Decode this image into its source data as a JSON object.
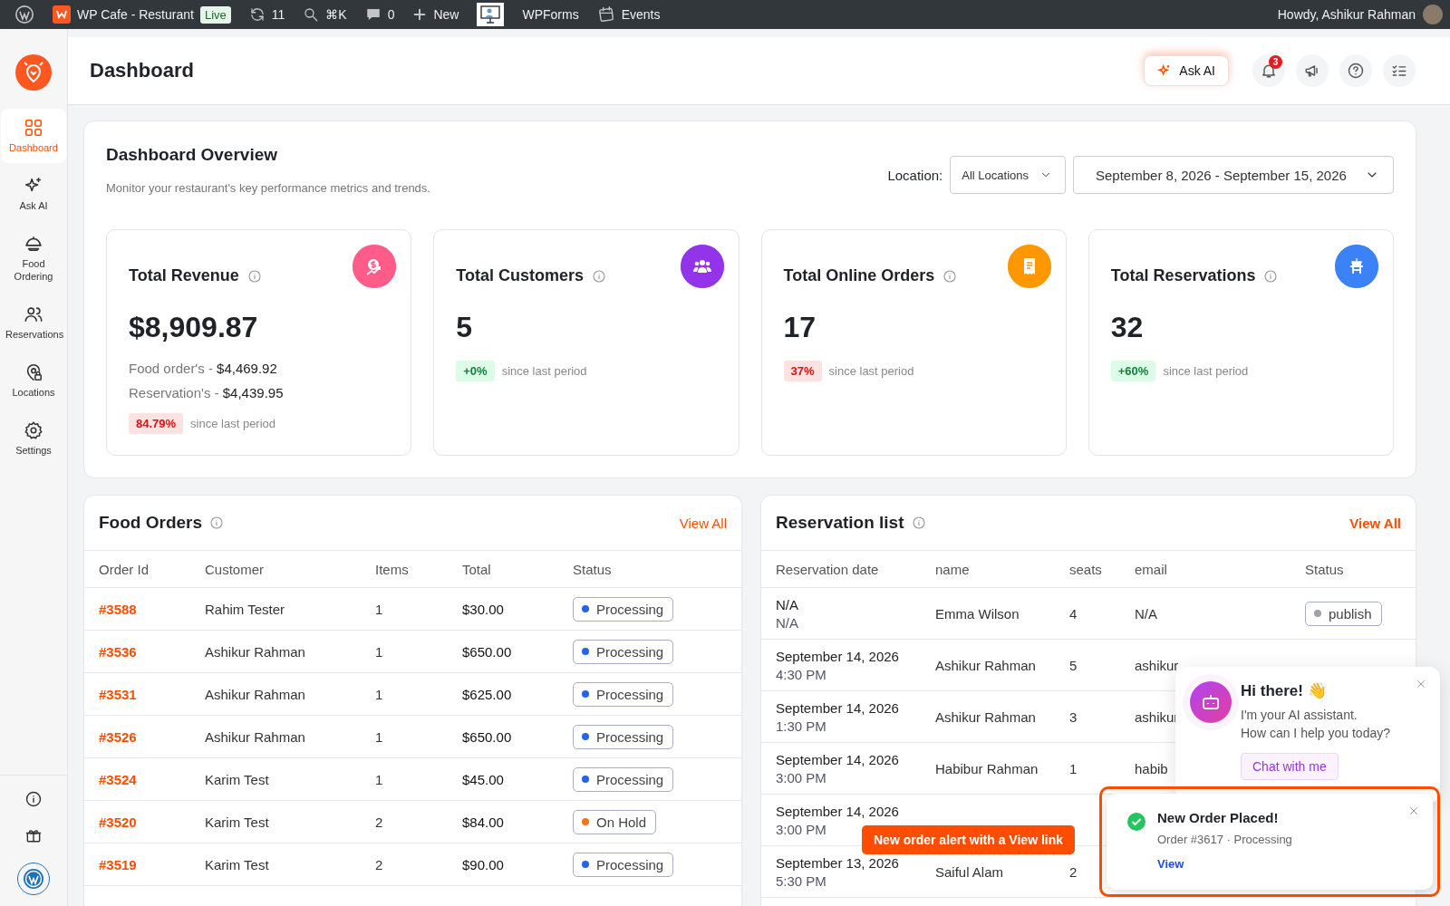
{
  "admin_bar": {
    "items": [
      {
        "kind": "wp"
      },
      {
        "kind": "site",
        "label": "WP Cafe - Resturant",
        "badge": "Live"
      },
      {
        "kind": "updates",
        "label": "11"
      },
      {
        "kind": "search",
        "label": "⌘K"
      },
      {
        "kind": "comments",
        "label": "0"
      },
      {
        "kind": "new",
        "label": "New"
      },
      {
        "kind": "monitor"
      },
      {
        "kind": "plain",
        "label": "WPForms"
      },
      {
        "kind": "events",
        "label": "Events"
      }
    ],
    "greeting": "Howdy, Ashikur Rahman"
  },
  "sidebar": {
    "items": [
      {
        "kind": "grid",
        "label": "Dashboard",
        "selected": true
      },
      {
        "kind": "sparkle",
        "label": "Ask AI",
        "selected": false
      },
      {
        "kind": "cloche",
        "label": "Food Ordering",
        "selected": false
      },
      {
        "kind": "users",
        "label": "Reservations",
        "selected": false
      },
      {
        "kind": "pin",
        "label": "Locations",
        "selected": false
      },
      {
        "kind": "gear",
        "label": "Settings",
        "selected": false
      }
    ],
    "bottom": [
      {
        "kind": "info"
      },
      {
        "kind": "gift"
      },
      {
        "kind": "wp"
      }
    ]
  },
  "header": {
    "title": "Dashboard",
    "ask_ai": "Ask AI",
    "notification_count": "3"
  },
  "overview": {
    "title": "Dashboard Overview",
    "subtitle": "Monitor your restaurant's key performance metrics and trends.",
    "location_label": "Location:",
    "location_value": "All Locations",
    "date_range": "September 8, 2026 - September 15, 2026",
    "cards": [
      {
        "kind": "revenue",
        "color": "#ff5c8a",
        "title": "Total Revenue",
        "value": "$8,909.87",
        "details": [
          {
            "label": "Food order's -",
            "value": "$4,469.92"
          },
          {
            "label": "Reservation's -",
            "value": "$4,439.95"
          }
        ],
        "change": "84.79%",
        "negative": true,
        "change_note": "since last period"
      },
      {
        "kind": "customers",
        "color": "#9333ea",
        "title": "Total Customers",
        "value": "5",
        "change": "+0%",
        "negative": false,
        "change_note": "since last period"
      },
      {
        "kind": "orders",
        "color": "#ff9800",
        "title": "Total Online Orders",
        "value": "17",
        "change": "37%",
        "negative": true,
        "change_note": "since last period"
      },
      {
        "kind": "reservations",
        "color": "#3b82f6",
        "title": "Total Reservations",
        "value": "32",
        "change": "+60%",
        "negative": false,
        "change_note": "since last period"
      }
    ]
  },
  "food_orders": {
    "title": "Food Orders",
    "view_all": "View All",
    "columns": [
      "Order Id",
      "Customer",
      "Items",
      "Total",
      "Status"
    ],
    "rows": [
      {
        "order_id": "#3588",
        "customer": "Rahim Tester",
        "items": "1",
        "total": "$30.00",
        "status": "Processing",
        "color": "#2563eb"
      },
      {
        "order_id": "#3536",
        "customer": "Ashikur Rahman",
        "items": "1",
        "total": "$650.00",
        "status": "Processing",
        "color": "#2563eb"
      },
      {
        "order_id": "#3531",
        "customer": "Ashikur Rahman",
        "items": "1",
        "total": "$625.00",
        "status": "Processing",
        "color": "#2563eb"
      },
      {
        "order_id": "#3526",
        "customer": "Ashikur Rahman",
        "items": "1",
        "total": "$650.00",
        "status": "Processing",
        "color": "#2563eb"
      },
      {
        "order_id": "#3524",
        "customer": "Karim Test",
        "items": "1",
        "total": "$45.00",
        "status": "Processing",
        "color": "#2563eb"
      },
      {
        "order_id": "#3520",
        "customer": "Karim Test",
        "items": "2",
        "total": "$84.00",
        "status": "On Hold",
        "color": "#f97316"
      },
      {
        "order_id": "#3519",
        "customer": "Karim Test",
        "items": "2",
        "total": "$90.00",
        "status": "Processing",
        "color": "#2563eb"
      }
    ]
  },
  "reservations": {
    "title": "Reservation list",
    "view_all": "View All",
    "columns": [
      "Reservation date",
      "name",
      "seats",
      "email",
      "Status"
    ],
    "rows": [
      {
        "date": "N/A",
        "time": "N/A",
        "name": "Emma Wilson",
        "seats": "4",
        "email": "N/A",
        "status": "publish",
        "color": "#9ca3af"
      },
      {
        "date": "September 14, 2026",
        "time": "4:30 PM",
        "name": "Ashikur Rahman",
        "seats": "5",
        "email": "ashikur"
      },
      {
        "date": "September 14, 2026",
        "time": "1:30 PM",
        "name": "Ashikur Rahman",
        "seats": "3",
        "email": "ashikur"
      },
      {
        "date": "September 14, 2026",
        "time": "3:00 PM",
        "name": "Habibur Rahman",
        "seats": "1",
        "email": "habib"
      },
      {
        "date": "September 14, 2026",
        "time": "3:00 PM"
      },
      {
        "date": "September 13, 2026",
        "time": "5:30 PM",
        "name": "Saiful Alam",
        "seats": "2"
      }
    ]
  },
  "chat_popup": {
    "title": "Hi there! 👋",
    "lines": [
      "I'm your AI assistant.",
      "How can I help you today?"
    ],
    "button": "Chat with me"
  },
  "toast": {
    "title": "New Order Placed!",
    "message": "Order #3617 · Processing",
    "link": "View",
    "highlighted": true
  },
  "callout": {
    "text": "New order alert with a View link"
  }
}
